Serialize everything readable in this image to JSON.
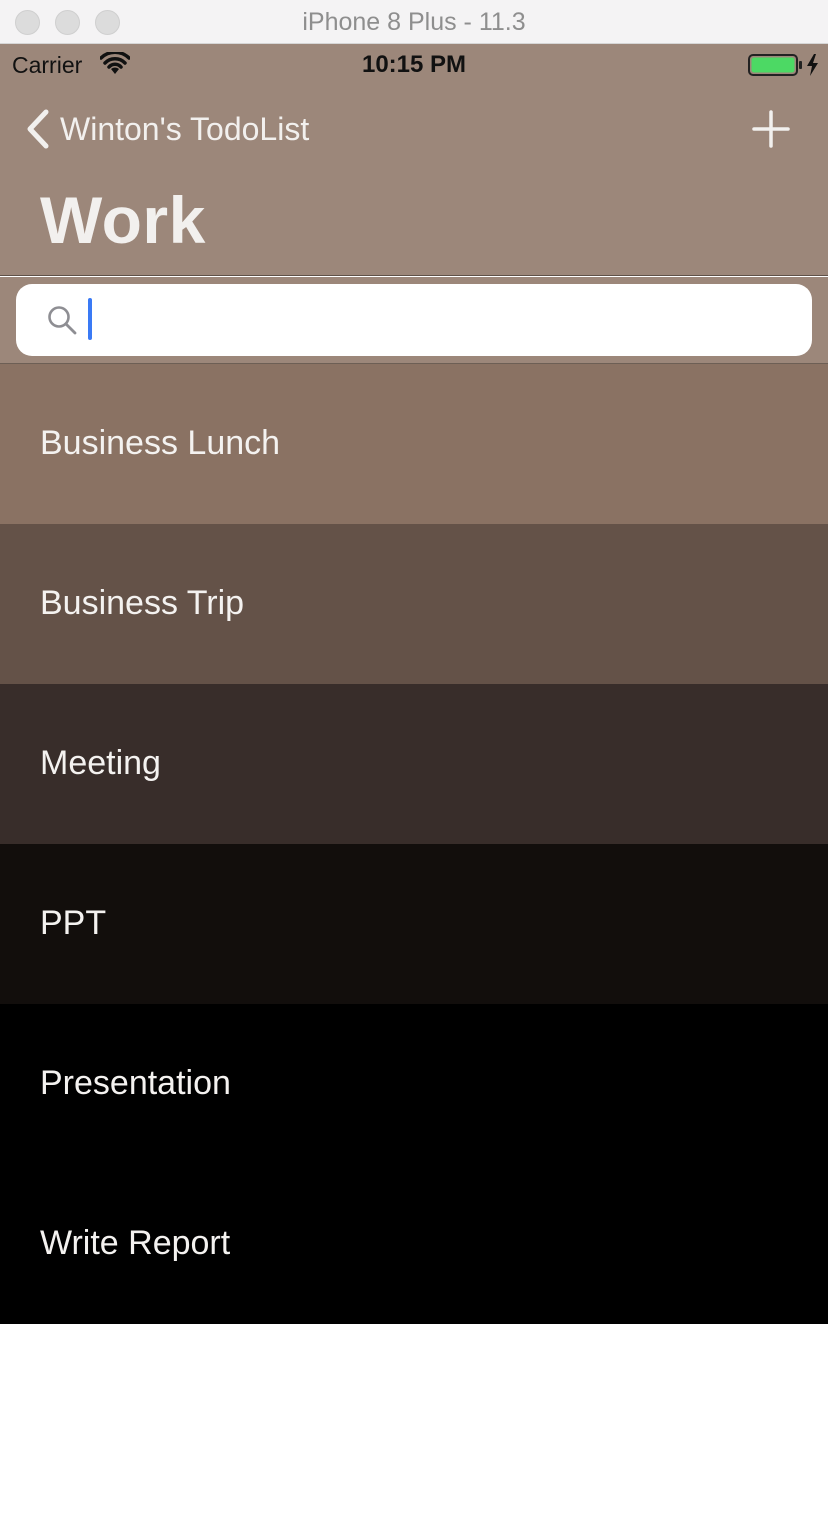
{
  "window": {
    "title": "iPhone 8 Plus - 11.3"
  },
  "status_bar": {
    "carrier": "Carrier",
    "time": "10:15 PM",
    "wifi_icon": "wifi-icon",
    "battery_icon": "battery-charging-icon",
    "battery_color": "#4cd964"
  },
  "nav": {
    "back_label": "Winton's TodoList",
    "back_icon": "chevron-left-icon",
    "add_icon": "plus-icon",
    "title": "Work"
  },
  "search": {
    "placeholder": "",
    "value": "",
    "icon": "search-icon",
    "cursor_color": "#3a7af5"
  },
  "colors": {
    "header_background": "#9c877a",
    "text_light": "#f4f2f0"
  },
  "items": [
    {
      "label": "Business Lunch",
      "color": "#8a7263"
    },
    {
      "label": "Business Trip",
      "color": "#645248"
    },
    {
      "label": "Meeting",
      "color": "#382d2a"
    },
    {
      "label": "PPT",
      "color": "#120e0c"
    },
    {
      "label": "Presentation",
      "color": "#000000"
    },
    {
      "label": "Write Report",
      "color": "#000000"
    }
  ]
}
